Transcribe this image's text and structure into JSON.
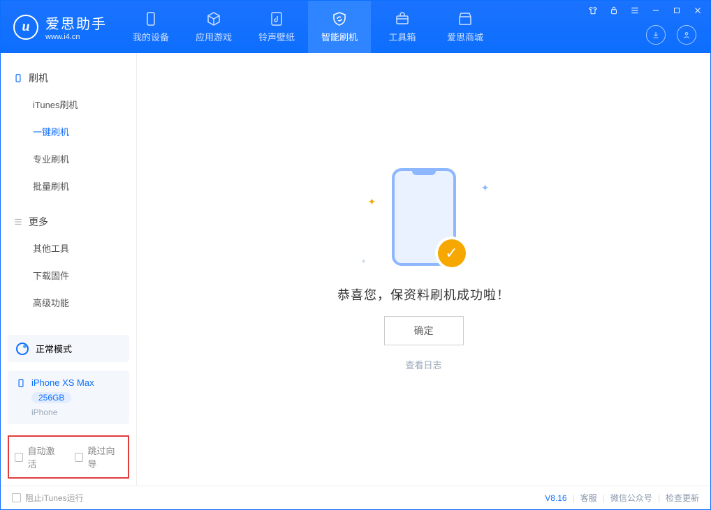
{
  "app": {
    "name_cn": "爱思助手",
    "name_en": "www.i4.cn"
  },
  "nav": {
    "items": [
      {
        "label": "我的设备"
      },
      {
        "label": "应用游戏"
      },
      {
        "label": "铃声壁纸"
      },
      {
        "label": "智能刷机"
      },
      {
        "label": "工具箱"
      },
      {
        "label": "爱思商城"
      }
    ]
  },
  "sidebar": {
    "group1_title": "刷机",
    "group1_items": [
      "iTunes刷机",
      "一键刷机",
      "专业刷机",
      "批量刷机"
    ],
    "group2_title": "更多",
    "group2_items": [
      "其他工具",
      "下载固件",
      "高级功能"
    ],
    "mode_label": "正常模式",
    "device_name": "iPhone XS Max",
    "device_storage": "256GB",
    "device_type": "iPhone",
    "chk1_label": "自动激活",
    "chk2_label": "跳过向导"
  },
  "main": {
    "message": "恭喜您，保资料刷机成功啦！",
    "confirm": "确定",
    "loglink": "查看日志"
  },
  "footer": {
    "block_itunes": "阻止iTunes运行",
    "version": "V8.16",
    "link1": "客服",
    "link2": "微信公众号",
    "link3": "检查更新"
  }
}
